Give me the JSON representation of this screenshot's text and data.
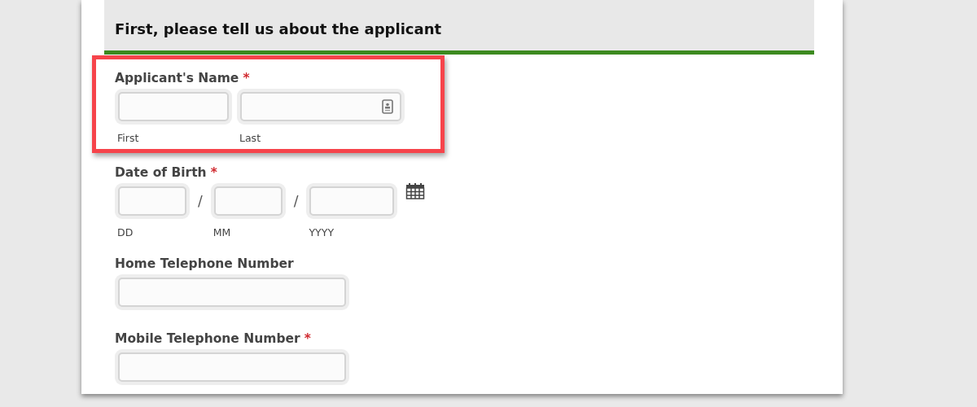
{
  "section": {
    "title": "First, please tell us about the applicant"
  },
  "fields": [
    {
      "kind": "name",
      "label": "Applicant's Name",
      "required_mark": "*",
      "highlighted": true,
      "parts": [
        {
          "sublabel": "First"
        },
        {
          "sublabel": "Last"
        }
      ]
    },
    {
      "kind": "date",
      "label": "Date of Birth",
      "required_mark": "*",
      "highlighted": false,
      "separator": "/",
      "parts": [
        {
          "sublabel": "DD"
        },
        {
          "sublabel": "MM"
        },
        {
          "sublabel": "YYYY"
        }
      ]
    },
    {
      "kind": "text",
      "label": "Home Telephone Number",
      "highlighted": false
    },
    {
      "kind": "text",
      "label": "Mobile Telephone Number",
      "required_mark": "*",
      "highlighted": false
    }
  ]
}
